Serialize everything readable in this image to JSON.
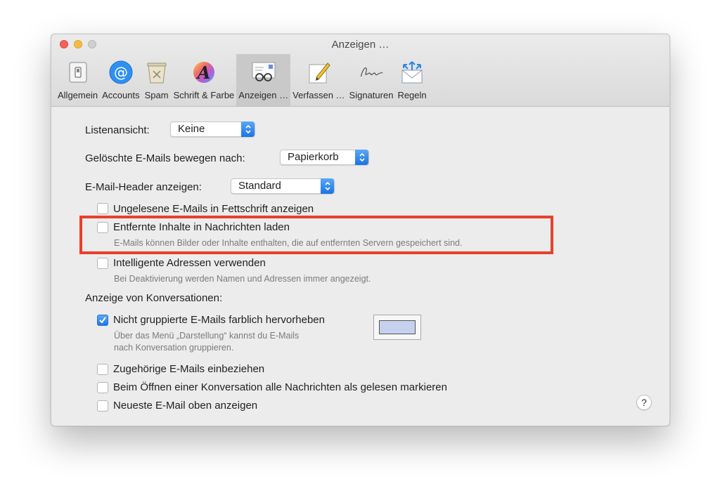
{
  "window": {
    "title": "Anzeigen …"
  },
  "toolbar": {
    "items": [
      {
        "label": "Allgemein",
        "icon": "switch-icon"
      },
      {
        "label": "Accounts",
        "icon": "at-sign-icon"
      },
      {
        "label": "Spam",
        "icon": "trash-bin-icon"
      },
      {
        "label": "Schrift & Farbe",
        "icon": "font-color-icon"
      },
      {
        "label": "Anzeigen …",
        "icon": "glasses-letter-icon"
      },
      {
        "label": "Verfassen …",
        "icon": "pencil-note-icon"
      },
      {
        "label": "Signaturen",
        "icon": "signature-icon"
      },
      {
        "label": "Regeln",
        "icon": "rules-envelope-icon"
      }
    ],
    "selected": "Anzeigen …"
  },
  "settings": {
    "list_view_label": "Listenansicht:",
    "list_view_value": "Keine",
    "deleted_move_label": "Gelöschte E-Mails bewegen nach:",
    "deleted_move_value": "Papierkorb",
    "header_label": "E-Mail-Header anzeigen:",
    "header_value": "Standard",
    "unread_bold_label": "Ungelesene E-Mails in Fettschrift anzeigen",
    "unread_bold_checked": false,
    "remote_content_label": "Entfernte Inhalte in Nachrichten laden",
    "remote_content_desc": "E-Mails können Bilder oder Inhalte enthalten, die auf entfernten Servern gespeichert sind.",
    "remote_content_checked": false,
    "smart_addresses_label": "Intelligente Adressen verwenden",
    "smart_addresses_desc": "Bei Deaktivierung werden Namen und Adressen immer angezeigt.",
    "smart_addresses_checked": false,
    "conversations_heading": "Anzeige von Konversationen:",
    "highlight_ungrouped_label": "Nicht gruppierte E-Mails farblich hervorheben",
    "highlight_ungrouped_desc_1": "Über das Menü „Darstellung“ kannst du E-Mails",
    "highlight_ungrouped_desc_2": "nach Konversation gruppieren.",
    "highlight_ungrouped_checked": true,
    "highlight_color": "#c5d1ee",
    "related_label": "Zugehörige E-Mails einbeziehen",
    "related_checked": false,
    "mark_read_label": "Beim Öffnen einer Konversation alle Nachrichten als gelesen markieren",
    "mark_read_checked": false,
    "newest_top_label": "Neueste E-Mail oben anzeigen",
    "newest_top_checked": false,
    "help_label": "?"
  },
  "colors": {
    "annotation_border": "#e8402c",
    "accent": "#1b73e6"
  }
}
